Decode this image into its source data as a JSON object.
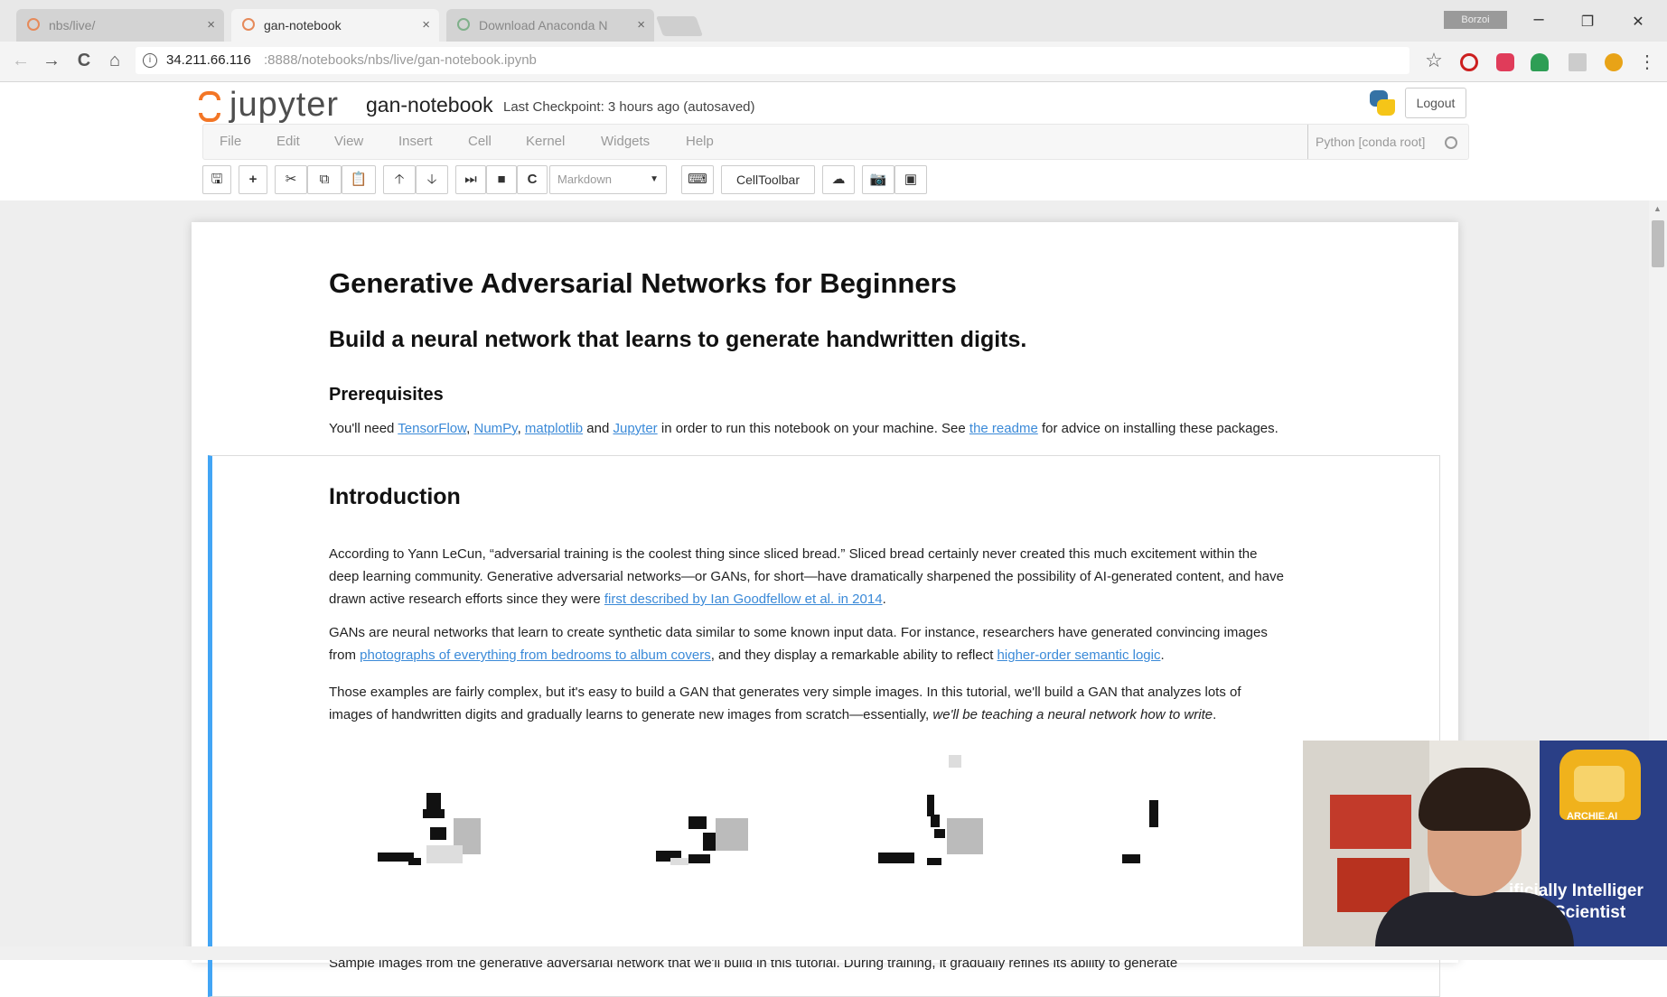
{
  "browser": {
    "tabs": [
      {
        "title": "nbs/live/",
        "active": false
      },
      {
        "title": "gan-notebook",
        "active": true
      },
      {
        "title": "Download Anaconda N",
        "active": false
      }
    ],
    "tab_close_glyph": "×",
    "profile_label": "Borzoi",
    "window_controls": {
      "minimize": "–",
      "restore": "❐",
      "close": "✕"
    },
    "nav": {
      "back": "←",
      "forward": "→",
      "reload": "C",
      "home": "⌂"
    },
    "address": {
      "info_glyph": "i",
      "host": "34.211.66.116",
      "path": ":8888/notebooks/nbs/live/gan-notebook.ipynb"
    },
    "star_glyph": "☆",
    "extension_icons": [
      "opera-icon",
      "pocket-icon",
      "extension-icon",
      "reader-icon",
      "chrome-icon"
    ],
    "menu_glyph": "⋮"
  },
  "jupyter": {
    "logo_text": "jupyter",
    "notebook_name": "gan-notebook",
    "checkpoint": "Last Checkpoint: 3 hours ago (autosaved)",
    "logout_label": "Logout",
    "menu": [
      "File",
      "Edit",
      "View",
      "Insert",
      "Cell",
      "Kernel",
      "Widgets",
      "Help"
    ],
    "kernel_name": "Python [conda root]",
    "toolbar": {
      "save": "🖫",
      "add": "+",
      "cut": "✂",
      "copy": "⧉",
      "paste": "📋",
      "up": "🡡",
      "down": "🡣",
      "run": "⏭",
      "stop": "■",
      "restart": "C",
      "cell_type": "Markdown",
      "cell_type_caret": "▼",
      "keyboard": "⌨",
      "celltoolbar": "CellToolbar",
      "upload": "☁",
      "camera1": "📷",
      "camera2": "▣"
    }
  },
  "notebook": {
    "title": "Generative Adversarial Networks for Beginners",
    "subtitle": "Build a neural network that learns to generate handwritten digits.",
    "prereq_heading": "Prerequisites",
    "prereq": {
      "t1": "You'll need ",
      "l1": "TensorFlow",
      "t2": ", ",
      "l2": "NumPy",
      "t3": ", ",
      "l3": "matplotlib",
      "t4": " and ",
      "l4": "Jupyter",
      "t5": " in order to run this notebook on your machine. See ",
      "l5": "the readme",
      "t6": " for advice on installing these packages."
    },
    "intro_heading": "Introduction",
    "p1": {
      "line1": "According to Yann LeCun, “adversarial training is the coolest thing since sliced bread.” Sliced bread certainly never created this much excitement within the",
      "line2": "deep learning community. Generative adversarial networks—or GANs, for short—have dramatically sharpened the possibility of AI-generated content, and have",
      "line3_pre": "drawn active research efforts since they were ",
      "line3_link": "first described by Ian Goodfellow et al. in 2014",
      "line3_post": "."
    },
    "p2": {
      "line1": "GANs are neural networks that learn to create synthetic data similar to some known input data. For instance, researchers have generated convincing images",
      "line2_pre": "from ",
      "line2_link1": "photographs of everything from bedrooms to album covers",
      "line2_mid": ", and they display a remarkable ability to reflect ",
      "line2_link2": "higher-order semantic logic",
      "line2_post": "."
    },
    "p3": {
      "line1": "Those examples are fairly complex, but it's easy to build a GAN that generates very simple images. In this tutorial, we'll build a GAN that analyzes lots of",
      "line2_pre": "images of handwritten digits and gradually learns to generate new images from scratch—essentially, ",
      "line2_em": "we'll be teaching a neural network how to write",
      "line2_post": "."
    },
    "caption": "Sample images from the generative adversarial network that we'll build in this tutorial. During training, it gradually refines its ability to generate"
  },
  "webcam": {
    "mascot_label": "ARCHIE.AI",
    "banner_line1": "ificially Intelliger",
    "banner_line2": "Scientist"
  }
}
